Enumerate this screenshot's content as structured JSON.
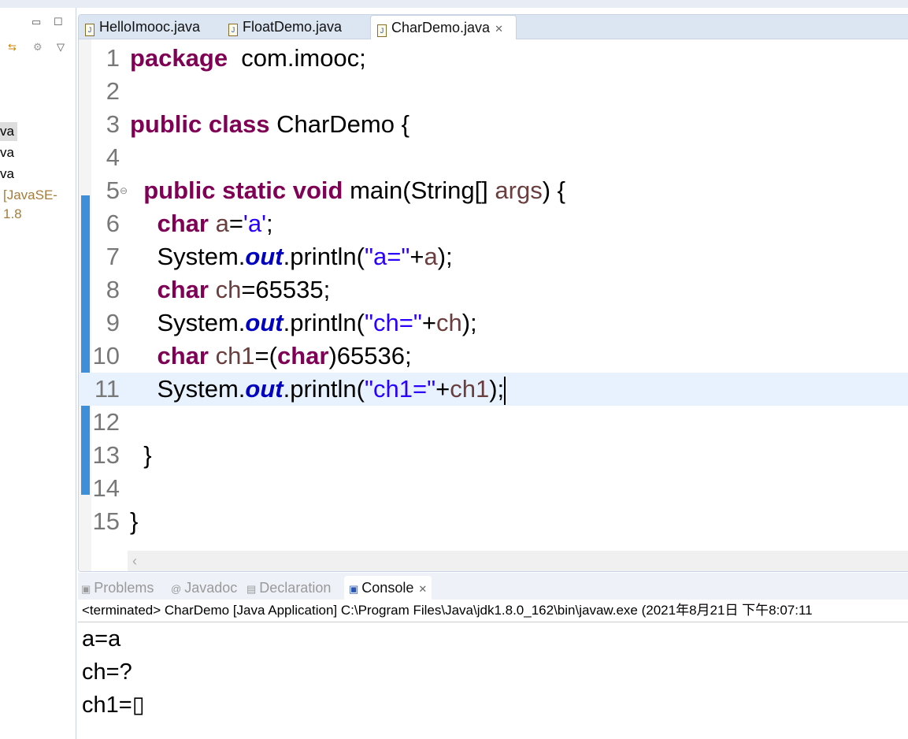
{
  "package_explorer": {
    "items": [
      "va",
      "va",
      "va",
      "[JavaSE-1.8"
    ]
  },
  "editor": {
    "tabs": [
      {
        "label": "HelloImooc.java"
      },
      {
        "label": "FloatDemo.java"
      },
      {
        "label": "CharDemo.java",
        "active": true
      }
    ],
    "lines": [
      {
        "n": "1",
        "tokens": [
          [
            "kw",
            "package"
          ],
          [
            "",
            "  com.imooc;"
          ]
        ]
      },
      {
        "n": "2",
        "tokens": []
      },
      {
        "n": "3",
        "tokens": [
          [
            "kw",
            "public class"
          ],
          [
            "",
            " CharDemo {"
          ]
        ]
      },
      {
        "n": "4",
        "tokens": []
      },
      {
        "n": "5",
        "tokens": [
          [
            "",
            "  "
          ],
          [
            "kw",
            "public static void"
          ],
          [
            "",
            " main(String[] "
          ],
          [
            "var",
            "args"
          ],
          [
            "",
            ") {"
          ]
        ],
        "fold": true
      },
      {
        "n": "6",
        "tokens": [
          [
            "",
            "    "
          ],
          [
            "kw",
            "char"
          ],
          [
            "",
            " "
          ],
          [
            "var",
            "a"
          ],
          [
            "",
            "="
          ],
          [
            "str",
            "'a'"
          ],
          [
            "",
            ";"
          ]
        ]
      },
      {
        "n": "7",
        "tokens": [
          [
            "",
            "    System."
          ],
          [
            "fld",
            "out"
          ],
          [
            "",
            ".println("
          ],
          [
            "str",
            "\"a=\""
          ],
          [
            "",
            "+"
          ],
          [
            "var",
            "a"
          ],
          [
            "",
            ");"
          ]
        ]
      },
      {
        "n": "8",
        "tokens": [
          [
            "",
            "    "
          ],
          [
            "kw",
            "char"
          ],
          [
            "",
            " "
          ],
          [
            "var",
            "ch"
          ],
          [
            "",
            "=65535;"
          ]
        ]
      },
      {
        "n": "9",
        "tokens": [
          [
            "",
            "    System."
          ],
          [
            "fld",
            "out"
          ],
          [
            "",
            ".println("
          ],
          [
            "str",
            "\"ch=\""
          ],
          [
            "",
            "+"
          ],
          [
            "var",
            "ch"
          ],
          [
            "",
            ");"
          ]
        ]
      },
      {
        "n": "10",
        "tokens": [
          [
            "",
            "    "
          ],
          [
            "kw",
            "char"
          ],
          [
            "",
            " "
          ],
          [
            "var",
            "ch1"
          ],
          [
            "",
            "=("
          ],
          [
            "kw",
            "char"
          ],
          [
            "",
            ")65536;"
          ]
        ]
      },
      {
        "n": "11",
        "tokens": [
          [
            "",
            "    System."
          ],
          [
            "fld",
            "out"
          ],
          [
            "",
            ".println("
          ],
          [
            "str",
            "\"ch1=\""
          ],
          [
            "",
            "+"
          ],
          [
            "var",
            "ch1"
          ],
          [
            "",
            ");"
          ]
        ],
        "current": true
      },
      {
        "n": "12",
        "tokens": []
      },
      {
        "n": "13",
        "tokens": [
          [
            "",
            "  }"
          ]
        ]
      },
      {
        "n": "14",
        "tokens": []
      },
      {
        "n": "15",
        "tokens": [
          [
            "",
            "}"
          ]
        ]
      }
    ]
  },
  "bottom": {
    "tabs": [
      {
        "label": "Problems"
      },
      {
        "label": "Javadoc"
      },
      {
        "label": "Declaration"
      },
      {
        "label": "Console",
        "active": true
      }
    ],
    "status": "<terminated> CharDemo [Java Application] C:\\Program Files\\Java\\jdk1.8.0_162\\bin\\javaw.exe (2021年8月21日 下午8:07:11",
    "output": [
      "a=a",
      "ch=?",
      "ch1=▯"
    ]
  }
}
